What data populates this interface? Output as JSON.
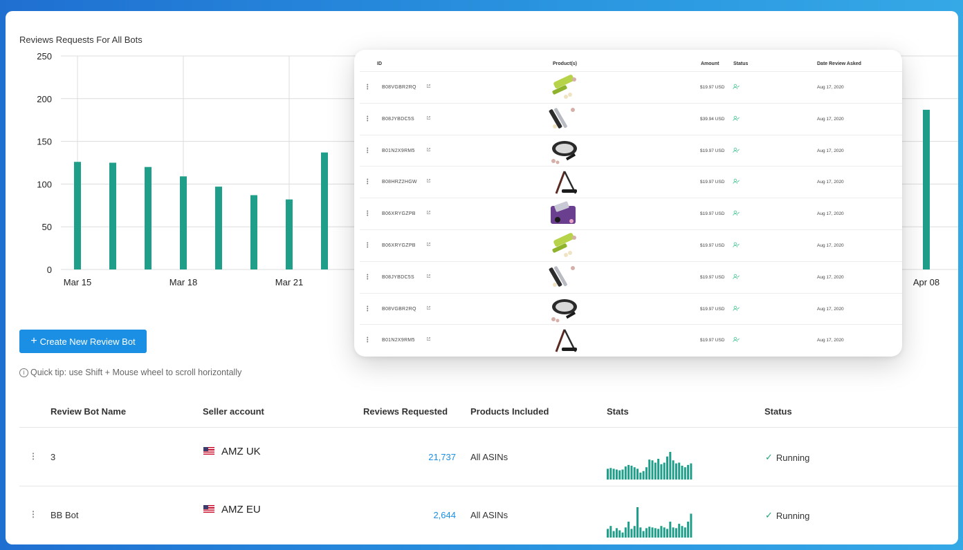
{
  "chart": {
    "title": "Reviews Requests For All Bots"
  },
  "chart_data": {
    "type": "bar",
    "title": "Reviews Requests For All Bots",
    "ylim": [
      0,
      250
    ],
    "yticks": [
      "0",
      "50",
      "100",
      "150",
      "200",
      "250"
    ],
    "xtick_labels": [
      "Mar 15",
      "Mar 18",
      "Mar 21",
      "Apr 08"
    ],
    "categories": [
      "Mar 15",
      "Mar 16",
      "Mar 17",
      "Mar 18",
      "Mar 19",
      "Mar 20",
      "Mar 21",
      "Mar 22",
      "Apr 08"
    ],
    "values": [
      126,
      125,
      120,
      109,
      97,
      87,
      82,
      137,
      187
    ],
    "grid": true,
    "color": "#1f9e8a"
  },
  "actions": {
    "create_label": "Create New Review Bot",
    "create_icon": "plus-icon"
  },
  "tip": {
    "icon": "info-icon",
    "text": "Quick tip: use Shift + Mouse wheel to scroll horizontally"
  },
  "table": {
    "headers": {
      "name": "Review Bot Name",
      "seller": "Seller account",
      "requested": "Reviews Requested",
      "products": "Products Included",
      "stats": "Stats",
      "status": "Status"
    },
    "rows": [
      {
        "name": "3",
        "seller": "AMZ UK",
        "requested": "21,737",
        "products": "All ASINs",
        "status": "Running",
        "stats": [
          14,
          15,
          14,
          13,
          12,
          13,
          17,
          19,
          18,
          16,
          14,
          9,
          11,
          16,
          26,
          25,
          22,
          27,
          20,
          22,
          30,
          36,
          25,
          21,
          22,
          18,
          16,
          19,
          21
        ]
      },
      {
        "name": "BB Bot",
        "seller": "AMZ EU",
        "requested": "2,644",
        "products": "All ASINs",
        "status": "Running",
        "stats": [
          12,
          16,
          9,
          13,
          10,
          7,
          14,
          22,
          12,
          16,
          42,
          14,
          9,
          13,
          15,
          14,
          13,
          12,
          16,
          14,
          12,
          22,
          14,
          13,
          19,
          16,
          14,
          22,
          33
        ]
      }
    ]
  },
  "card": {
    "headers": {
      "id": "ID",
      "products": "Product(s)",
      "amount": "Amount",
      "status": "Status",
      "date": "Date Review Asked"
    },
    "rows": [
      {
        "id": "B08VGBR2RQ",
        "amount": "$19.97 USD",
        "date": "Aug 17, 2020",
        "product": "garlic-press-green"
      },
      {
        "id": "B08JYBDC5S",
        "amount": "$39.94 USD",
        "date": "Aug 17, 2020",
        "product": "garlic-press-steel"
      },
      {
        "id": "B01N2X9RM5",
        "amount": "$19.97 USD",
        "date": "Aug 17, 2020",
        "product": "garlic-rocker"
      },
      {
        "id": "B08HRZ2HGW",
        "amount": "$19.97 USD",
        "date": "Aug 17, 2020",
        "product": "garlic-press-black"
      },
      {
        "id": "B06XRYGZPB",
        "amount": "$19.97 USD",
        "date": "Aug 17, 2020",
        "product": "garlic-press-purple"
      },
      {
        "id": "B06XRYGZPB",
        "amount": "$19.97 USD",
        "date": "Aug 17, 2020",
        "product": "garlic-press-green"
      },
      {
        "id": "B08JYBDC5S",
        "amount": "$19.97 USD",
        "date": "Aug 17, 2020",
        "product": "garlic-press-steel"
      },
      {
        "id": "B08VGBR2RQ",
        "amount": "$19.97 USD",
        "date": "Aug 17, 2020",
        "product": "garlic-rocker"
      },
      {
        "id": "B01N2X9RM5",
        "amount": "$19.97 USD",
        "date": "Aug 17, 2020",
        "product": "garlic-press-black"
      }
    ]
  },
  "colors": {
    "accent": "#1a8fe3",
    "bar": "#1f9e8a",
    "status_ok": "#1ea37a"
  }
}
